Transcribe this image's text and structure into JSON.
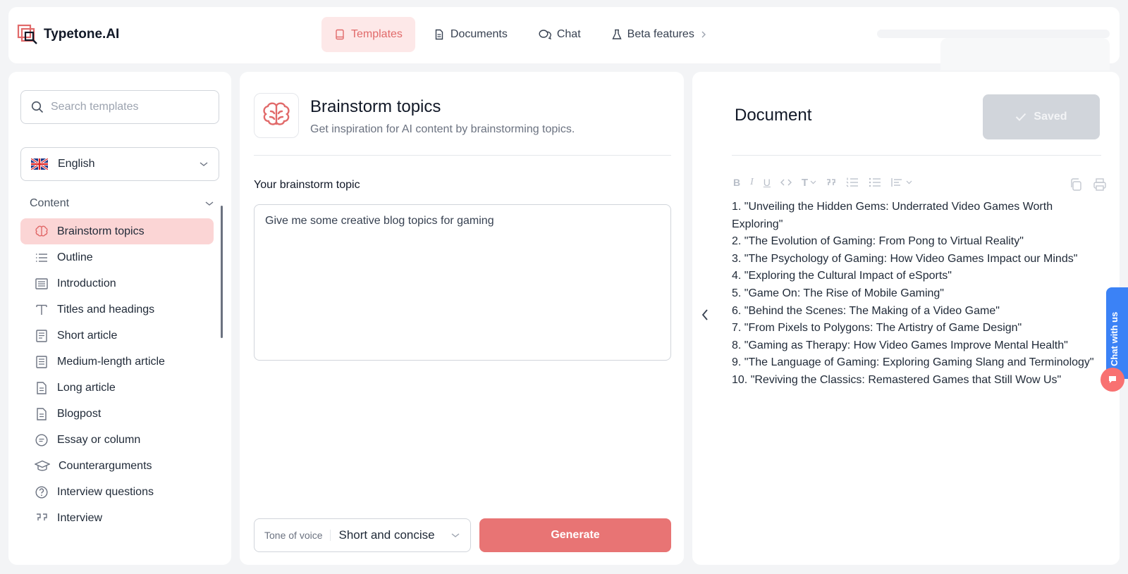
{
  "app": {
    "brand": "Typetone.AI"
  },
  "nav": [
    {
      "label": "Templates",
      "icon": "book-icon",
      "active": true
    },
    {
      "label": "Documents",
      "icon": "document-icon",
      "active": false
    },
    {
      "label": "Chat",
      "icon": "chat-icon",
      "active": false
    },
    {
      "label": "Beta features",
      "icon": "flask-icon",
      "active": false
    }
  ],
  "sidebar": {
    "search_placeholder": "Search templates",
    "language": "English",
    "section": "Content",
    "items": [
      {
        "label": "Brainstorm topics",
        "icon": "brain-icon",
        "active": true
      },
      {
        "label": "Outline",
        "icon": "list-icon"
      },
      {
        "label": "Introduction",
        "icon": "paragraph-icon"
      },
      {
        "label": "Titles and headings",
        "icon": "text-icon"
      },
      {
        "label": "Short article",
        "icon": "article-icon"
      },
      {
        "label": "Medium-length article",
        "icon": "article-icon"
      },
      {
        "label": "Long article",
        "icon": "file-icon"
      },
      {
        "label": "Blogpost",
        "icon": "file-icon"
      },
      {
        "label": "Essay or column",
        "icon": "speech-icon"
      },
      {
        "label": "Counterarguments",
        "icon": "graduation-cap-icon"
      },
      {
        "label": "Interview questions",
        "icon": "question-icon"
      },
      {
        "label": "Interview",
        "icon": "quote-icon"
      }
    ]
  },
  "template": {
    "title": "Brainstorm topics",
    "subtitle": "Get inspiration for AI content by brainstorming topics.",
    "field_label": "Your brainstorm topic",
    "input_value": "Give me some creative blog topics for gaming",
    "tone_label": "Tone of voice",
    "tone_value": "Short and concise",
    "generate_label": "Generate"
  },
  "document": {
    "title": "Document",
    "saved_label": "Saved",
    "lines": [
      "1. \"Unveiling the Hidden Gems: Underrated Video Games Worth Exploring\"",
      "2. \"The Evolution of Gaming: From Pong to Virtual Reality\"",
      "3. \"The Psychology of Gaming: How Video Games Impact our Minds\"",
      "4. \"Exploring the Cultural Impact of eSports\"",
      "5. \"Game On: The Rise of Mobile Gaming\"",
      "6. \"Behind the Scenes: The Making of a Video Game\"",
      "7. \"From Pixels to Polygons: The Artistry of Game Design\"",
      "8. \"Gaming as Therapy: How Video Games Improve Mental Health\"",
      "9. \"The Language of Gaming: Exploring Gaming Slang and Terminology\"",
      "10. \"Reviving the Classics: Remastered Games that Still Wow Us\""
    ]
  },
  "chat_widget": {
    "label": "Chat with us"
  },
  "colors": {
    "accent": "#e87474",
    "accent_light": "#fde8e8",
    "chat_tab": "#3b82f6"
  }
}
